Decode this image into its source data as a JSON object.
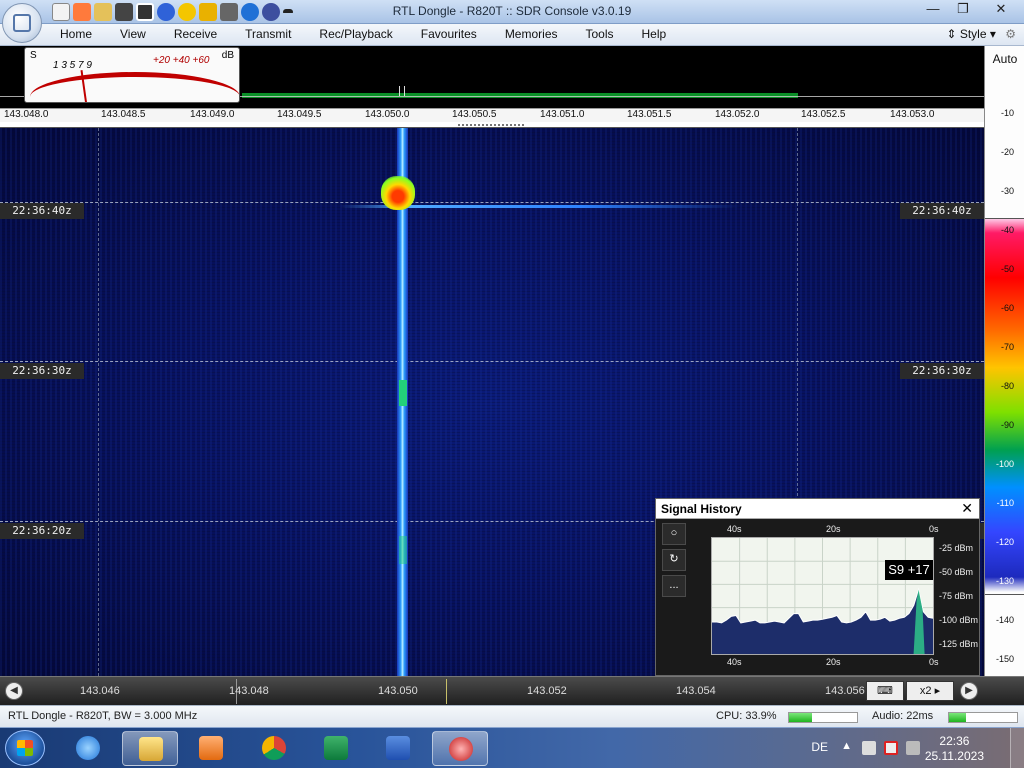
{
  "window": {
    "title": "RTL Dongle - R820T :: SDR Console v3.0.19",
    "minimize": "—",
    "maximize": "❐",
    "close": "✕"
  },
  "menu": {
    "items": [
      "Home",
      "View",
      "Receive",
      "Transmit",
      "Rec/Playback",
      "Favourites",
      "Memories",
      "Tools",
      "Help"
    ],
    "style_label": "Style"
  },
  "smeter": {
    "s_label": "S",
    "db_label": "dB",
    "s_scale": "1   3   5   7   9",
    "db_scale": "+20  +40  +60"
  },
  "frequency_ruler": {
    "labels": [
      "143.048.0",
      "143.048.5",
      "143.049.0",
      "143.049.5",
      "143.050.0",
      "143.050.5",
      "143.051.0",
      "143.051.5",
      "143.052.0",
      "143.052.5",
      "143.053.0"
    ]
  },
  "waterfall": {
    "time_tags": [
      "22:36:40z",
      "22:36:30z",
      "22:36:20z"
    ]
  },
  "levelbar": {
    "auto_label": "Auto",
    "scale": [
      "-10",
      "-20",
      "-30",
      "-40",
      "-50",
      "-60",
      "-70",
      "-80",
      "-90",
      "-100",
      "-110",
      "-120",
      "-130",
      "-140",
      "-150"
    ]
  },
  "signal_history": {
    "title": "Signal History",
    "close": "✕",
    "tools": [
      "○",
      "↻",
      "..."
    ],
    "time_labels": [
      "40s",
      "20s",
      "0s"
    ],
    "dbm_labels": [
      "-25 dBm",
      "-50 dBm",
      "-75 dBm",
      "-100 dBm",
      "-125 dBm"
    ],
    "reading": "S9 +17",
    "history_dbm": [
      -103,
      -103,
      -104,
      -101,
      -97,
      -96,
      -104,
      -103,
      -102,
      -101,
      -104,
      -104,
      -103,
      -102,
      -103,
      -104,
      -99,
      -94,
      -94,
      -103,
      -102,
      -101,
      -101,
      -100,
      -99,
      -98,
      -96,
      -103,
      -104,
      -103,
      -101,
      -98,
      -92,
      -101,
      -101,
      -100,
      -98,
      -102,
      -101,
      -99,
      -98,
      -94,
      -85,
      -68,
      -92,
      -98,
      -99
    ]
  },
  "bottom_bar": {
    "freqs": [
      "143.046",
      "143.048",
      "143.050",
      "143.052",
      "143.054",
      "143.056"
    ],
    "zoom": "x2",
    "prev": "◀",
    "next": "▶"
  },
  "status": {
    "device": "RTL Dongle - R820T, BW = 3.000 MHz",
    "cpu": "CPU: 33.9%",
    "cpu_level": 0.339,
    "audio": "Audio: 22ms",
    "audio_level": 0.25
  },
  "taskbar": {
    "apps": [
      "internet-explorer",
      "file-explorer",
      "media-player",
      "chrome",
      "excel",
      "word",
      "sdr-console"
    ],
    "active_app": "sdr-console",
    "language": "DE",
    "time": "22:36",
    "date": "25.11.2023"
  }
}
